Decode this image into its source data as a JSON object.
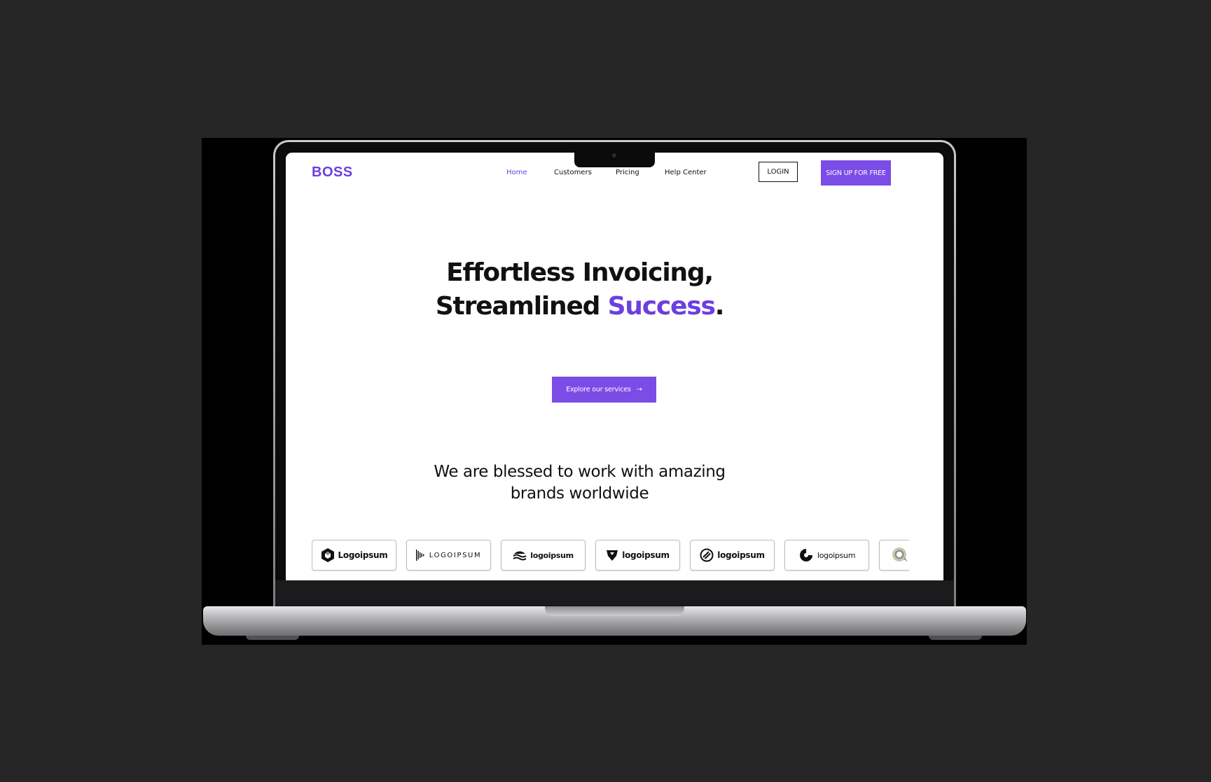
{
  "site": {
    "brand": "BOSS",
    "accent_color": "#7b4ce6"
  },
  "nav": {
    "items": [
      {
        "label": "Home",
        "active": true
      },
      {
        "label": "Customers",
        "active": false
      },
      {
        "label": "Pricing",
        "active": false
      },
      {
        "label": "Help Center",
        "active": false
      }
    ],
    "login_label": "LOGIN",
    "signup_label": "SIGN UP FOR FREE"
  },
  "hero": {
    "line1": "Effortless Invoicing,",
    "line2_prefix": "Streamlined ",
    "line2_accent": "Success",
    "line2_suffix": ".",
    "cta_label": "Explore our services",
    "cta_icon": "arrow-right-icon"
  },
  "brands": {
    "heading_line1": "We are blessed to work with amazing",
    "heading_line2": "brands worldwide",
    "logos": [
      {
        "text": "Logoipsum",
        "icon": "hexagon-logo-icon"
      },
      {
        "text": "LOGOIPSUM",
        "icon": "bars-logo-icon"
      },
      {
        "text": "logoipsum",
        "icon": "waves-logo-icon"
      },
      {
        "text": "logoipsum",
        "icon": "shield-logo-icon"
      },
      {
        "text": "logoipsum",
        "icon": "striped-circle-logo-icon"
      },
      {
        "text": "logoipsum",
        "icon": "ring-logo-icon"
      },
      {
        "text": "",
        "icon": "chat-bubble-logo-icon"
      }
    ]
  }
}
